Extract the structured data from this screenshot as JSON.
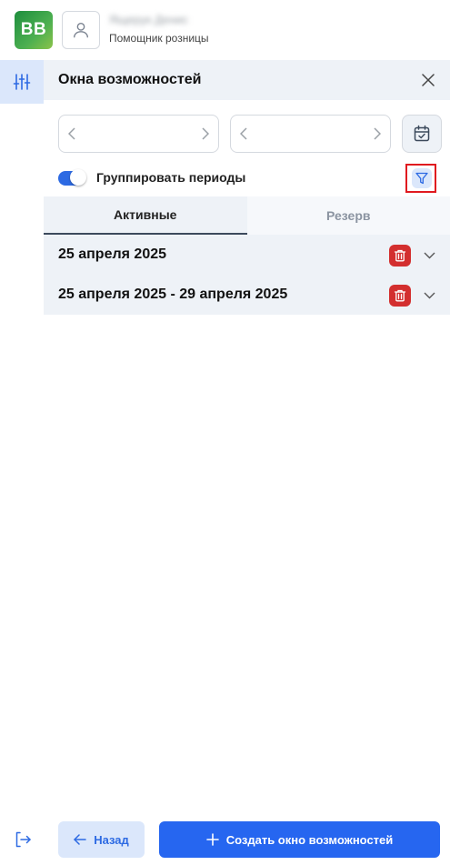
{
  "app": {
    "logo_text": "BB",
    "user_name": "Ящерук Денис",
    "user_role": "Помощник розницы"
  },
  "panel": {
    "title": "Окна возможностей"
  },
  "filters": {
    "group_periods_label": "Группировать периоды",
    "group_periods_on": true
  },
  "tabs": [
    {
      "label": "Активные",
      "active": true
    },
    {
      "label": "Резерв",
      "active": false
    }
  ],
  "periods": [
    {
      "title": "25 апреля 2025"
    },
    {
      "title": "25 апреля 2025 - 29 апреля 2025"
    }
  ],
  "footer": {
    "back_label": "Назад",
    "create_label": "Создать окно возможностей"
  },
  "colors": {
    "accent": "#2666f0",
    "danger": "#d32f2f",
    "highlight": "#e0191f"
  }
}
